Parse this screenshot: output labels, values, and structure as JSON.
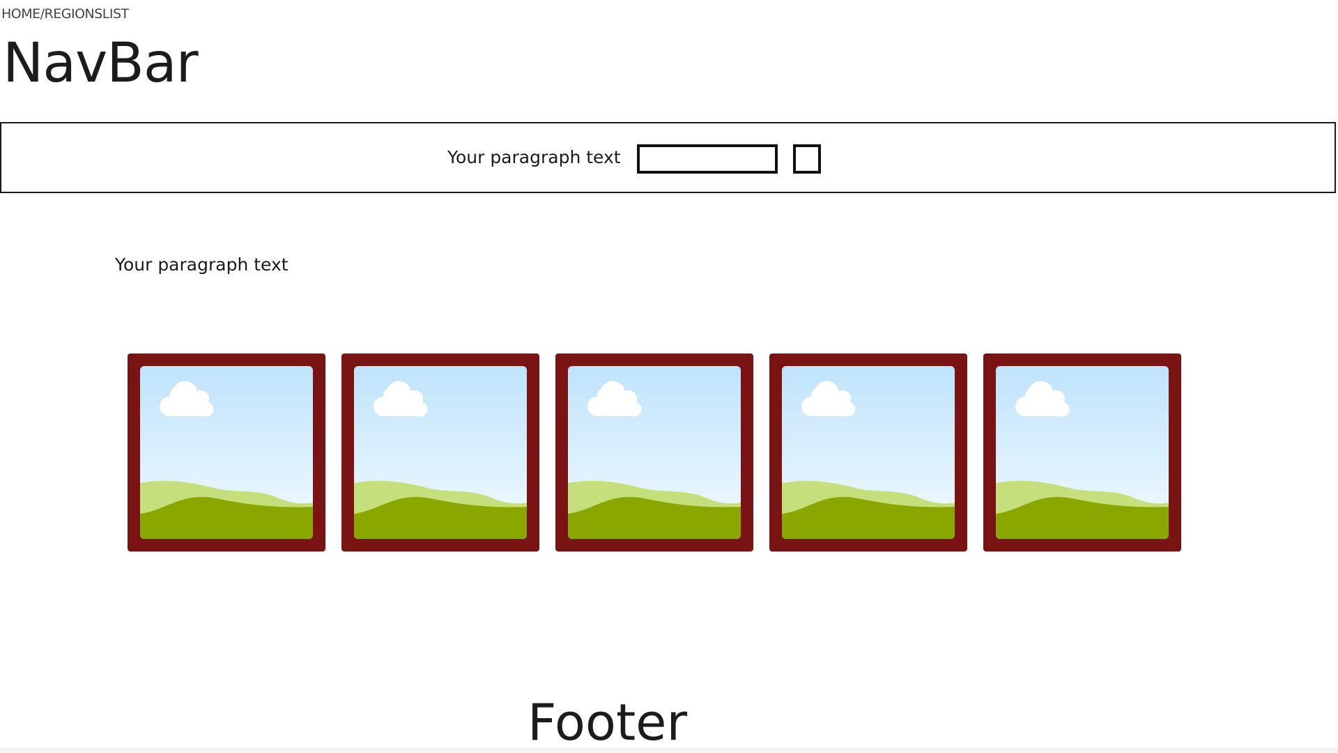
{
  "breadcrumb": "HOME/REGIONSLIST",
  "navbar": {
    "title": "NavBar"
  },
  "search": {
    "label": "Your paragraph text",
    "input_value": "",
    "button_label": ""
  },
  "intro": {
    "text": "Your paragraph text"
  },
  "gallery": {
    "items": [
      {
        "icon": "image-placeholder-icon"
      },
      {
        "icon": "image-placeholder-icon"
      },
      {
        "icon": "image-placeholder-icon"
      },
      {
        "icon": "image-placeholder-icon"
      },
      {
        "icon": "image-placeholder-icon"
      }
    ],
    "frame_color": "#7a1414"
  },
  "footer": {
    "title": "Footer"
  }
}
